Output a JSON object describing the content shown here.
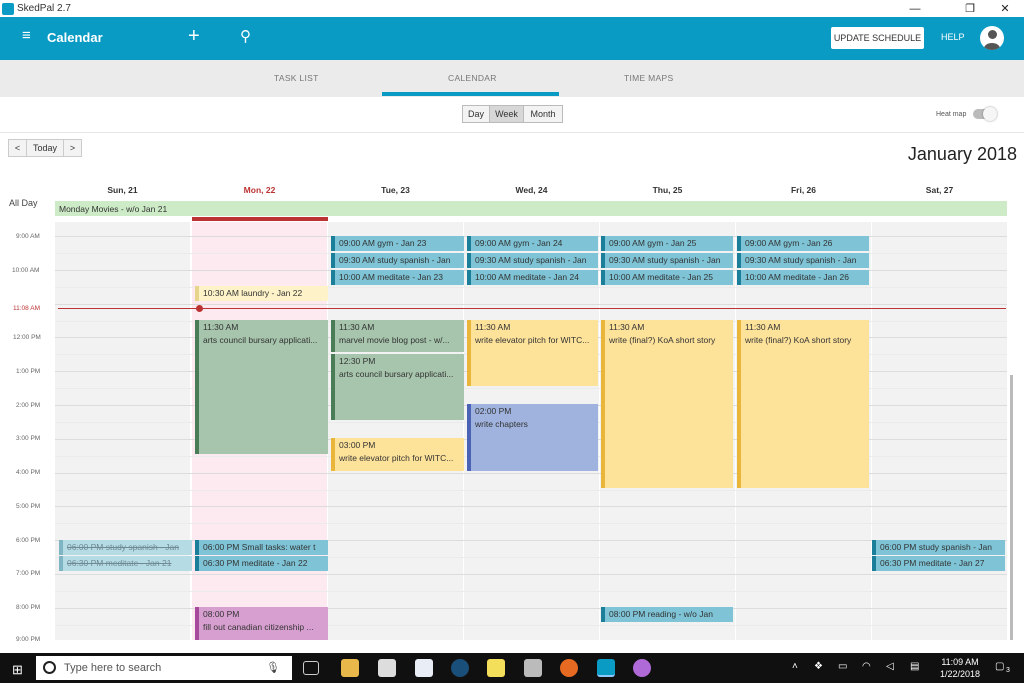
{
  "window": {
    "title": "SkedPal 2.7",
    "minimize": "—",
    "restore": "❐",
    "close": "✕"
  },
  "appbar": {
    "title": "Calendar",
    "menu_icon": "≡",
    "add_icon": "+",
    "search_icon": "⚲",
    "update_button": "UPDATE SCHEDULE",
    "help": "HELP"
  },
  "tabs": [
    "TASK LIST",
    "CALENDAR",
    "TIME MAPS"
  ],
  "view": {
    "day": "Day",
    "week": "Week",
    "month": "Month",
    "heat_map": "Heat map"
  },
  "nav": {
    "prev": "<",
    "today": "Today",
    "next": ">"
  },
  "month_title": "January 2018",
  "days": [
    "Sun, 21",
    "Mon, 22",
    "Tue, 23",
    "Wed, 24",
    "Thu, 25",
    "Fri, 26",
    "Sat, 27"
  ],
  "allday": {
    "label": "All Day",
    "event": "Monday Movies - w/o Jan 21"
  },
  "time_labels": [
    "9:00 AM",
    "10:00 AM",
    "12:00 PM",
    "1:00 PM",
    "2:00 PM",
    "3:00 PM",
    "4:00 PM",
    "5:00 PM",
    "6:00 PM",
    "7:00 PM",
    "8:00 PM",
    "9:00 PM"
  ],
  "now_label": "11:08 AM",
  "events": {
    "tue_gym": "09:00 AM  gym - Jan  23",
    "tue_spanish": "09:30 AM  study spanish - Jan",
    "tue_meditate": "10:00 AM  meditate - Jan  23",
    "wed_gym": "09:00 AM  gym - Jan  24",
    "wed_spanish": "09:30 AM  study spanish - Jan",
    "wed_meditate": "10:00 AM  meditate - Jan  24",
    "thu_gym": "09:00 AM  gym - Jan  25",
    "thu_spanish": "09:30 AM  study spanish - Jan",
    "thu_meditate": "10:00 AM  meditate - Jan  25",
    "fri_gym": "09:00 AM  gym - Jan  26",
    "fri_spanish": "09:30 AM  study spanish - Jan",
    "fri_meditate": "10:00 AM  meditate - Jan  26",
    "mon_laundry": "10:30 AM  laundry - Jan  22",
    "mon_arts_time": "11:30 AM",
    "mon_arts_title": "arts council bursary applicati...",
    "tue_blog_time": "11:30 AM",
    "tue_blog_title": "marvel movie blog post - w/...",
    "tue_arts_time": "12:30 PM",
    "tue_arts_title": "arts council bursary applicati...",
    "tue_pitch_time": "03:00 PM",
    "tue_pitch_title": "write elevator pitch for WITC...",
    "wed_pitch_time": "11:30 AM",
    "wed_pitch_title": "write elevator pitch for WITC...",
    "wed_chapters_time": "02:00 PM",
    "wed_chapters_title": "write chapters",
    "thu_story_time": "11:30 AM",
    "thu_story_title": "write (final?) KoA short story",
    "fri_story_time": "11:30 AM",
    "fri_story_title": "write (final?) KoA short story",
    "sun_spanish": "06:00 PM  study spanish - Jan",
    "sun_meditate": "06:30 PM  meditate - Jan  21",
    "mon_small": "06:00 PM  Small tasks: water t",
    "mon_meditate": "06:30 PM  meditate - Jan  22",
    "sat_spanish": "06:00 PM  study spanish - Jan",
    "sat_meditate": "06:30 PM  meditate - Jan  27",
    "mon_citizen_time": "08:00 PM",
    "mon_citizen_title": "fill out canadian citizenship ...",
    "thu_reading": "08:00 PM  reading - w/o Jan"
  },
  "taskbar": {
    "search_placeholder": "Type here to search",
    "time": "11:09 AM",
    "date": "1/22/2018",
    "notifications": "3"
  },
  "colors": {
    "accent": "#0a9bc5",
    "today": "#b33333"
  }
}
